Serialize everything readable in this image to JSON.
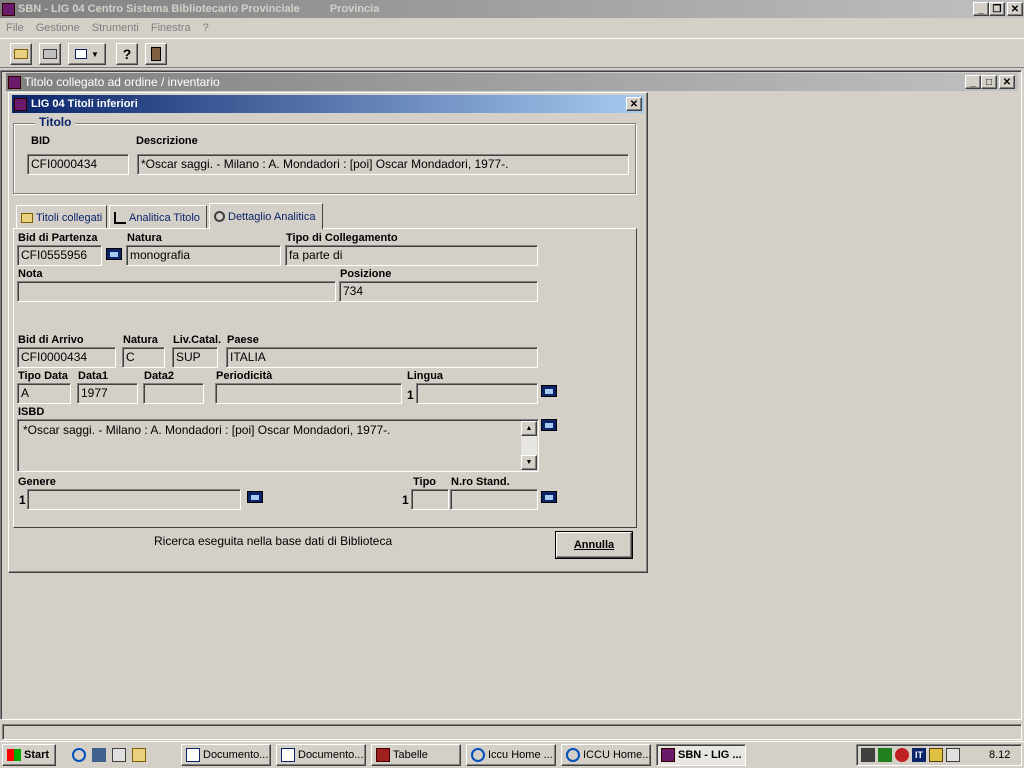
{
  "app": {
    "title": "SBN - LIG 04 Centro Sistema Bibliotecario Provinciale",
    "subtitle": "Provincia",
    "menu": [
      "File",
      "Gestione",
      "Strumenti",
      "Finestra",
      "?"
    ]
  },
  "mdi": {
    "title": "Titolo collegato ad ordine / inventario"
  },
  "dialog": {
    "title": "LIG  04  Titoli inferiori",
    "titolo_group": "Titolo",
    "bid_label": "BID",
    "bid_value": "CFI0000434",
    "descrizione_label": "Descrizione",
    "descrizione_value": "*Oscar saggi. - Milano : A. Mondadori : [poi] Oscar Mondadori, 1977-.",
    "tabs": [
      "Titoli collegati",
      "Analitica Titolo",
      "Dettaglio Analitica"
    ],
    "detail": {
      "bid_partenza_label": "Bid di Partenza",
      "bid_partenza_value": "CFI0555956",
      "natura_label": "Natura",
      "natura_value": "monografia",
      "tipo_coll_label": "Tipo di Collegamento",
      "tipo_coll_value": "fa parte di",
      "nota_label": "Nota",
      "nota_value": "",
      "posizione_label": "Posizione",
      "posizione_value": "734",
      "bid_arrivo_label": "Bid di Arrivo",
      "bid_arrivo_value": "CFI0000434",
      "natura2_label": "Natura",
      "natura2_value": "C",
      "livcatal_label": "Liv.Catal.",
      "livcatal_value": "SUP",
      "paese_label": "Paese",
      "paese_value": "ITALIA",
      "tipo_data_label": "Tipo Data",
      "tipo_data_value": "A",
      "data1_label": "Data1",
      "data1_value": "1977",
      "data2_label": "Data2",
      "data2_value": "",
      "periodicita_label": "Periodicità",
      "periodicita_value": "",
      "lingua_label": "Lingua",
      "lingua_index": "1",
      "lingua_value": "",
      "isbd_label": "ISBD",
      "isbd_value": "*Oscar saggi. - Milano : A. Mondadori : [poi] Oscar Mondadori, 1977-.",
      "genere_label": "Genere",
      "genere_index": "1",
      "genere_value": "",
      "tipo_label": "Tipo",
      "tipo_index": "1",
      "tipo_value": "",
      "nro_stand_label": "N.ro Stand.",
      "nro_stand_value": ""
    },
    "status_text": "Ricerca eseguita nella base dati di Biblioteca",
    "annulla_label": "Annulla"
  },
  "taskbar": {
    "start_label": "Start",
    "items": [
      "Documento...",
      "Documento...",
      "Tabelle",
      "Iccu Home ...",
      "ICCU Home...",
      "SBN - LIG ..."
    ],
    "clock": "8.12"
  },
  "colors": {
    "face": "#d4d0c8",
    "active_title": "#0a246a",
    "inactive_title": "#808080",
    "group_title": "#0a246a"
  }
}
